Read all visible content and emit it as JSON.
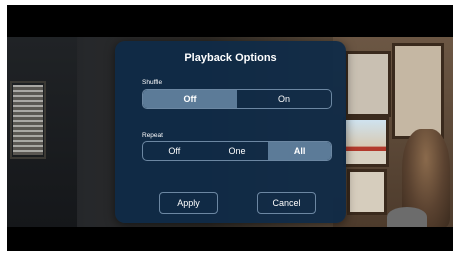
{
  "dialog": {
    "title": "Playback Options",
    "background_color": "#0f2a47",
    "accent_color": "#5c7b98"
  },
  "shuffle": {
    "label": "Shuffle",
    "options": [
      "Off",
      "On"
    ],
    "selected": "Off"
  },
  "repeat": {
    "label": "Repeat",
    "options": [
      "Off",
      "One",
      "All"
    ],
    "selected": "All"
  },
  "actions": {
    "apply_label": "Apply",
    "cancel_label": "Cancel"
  }
}
